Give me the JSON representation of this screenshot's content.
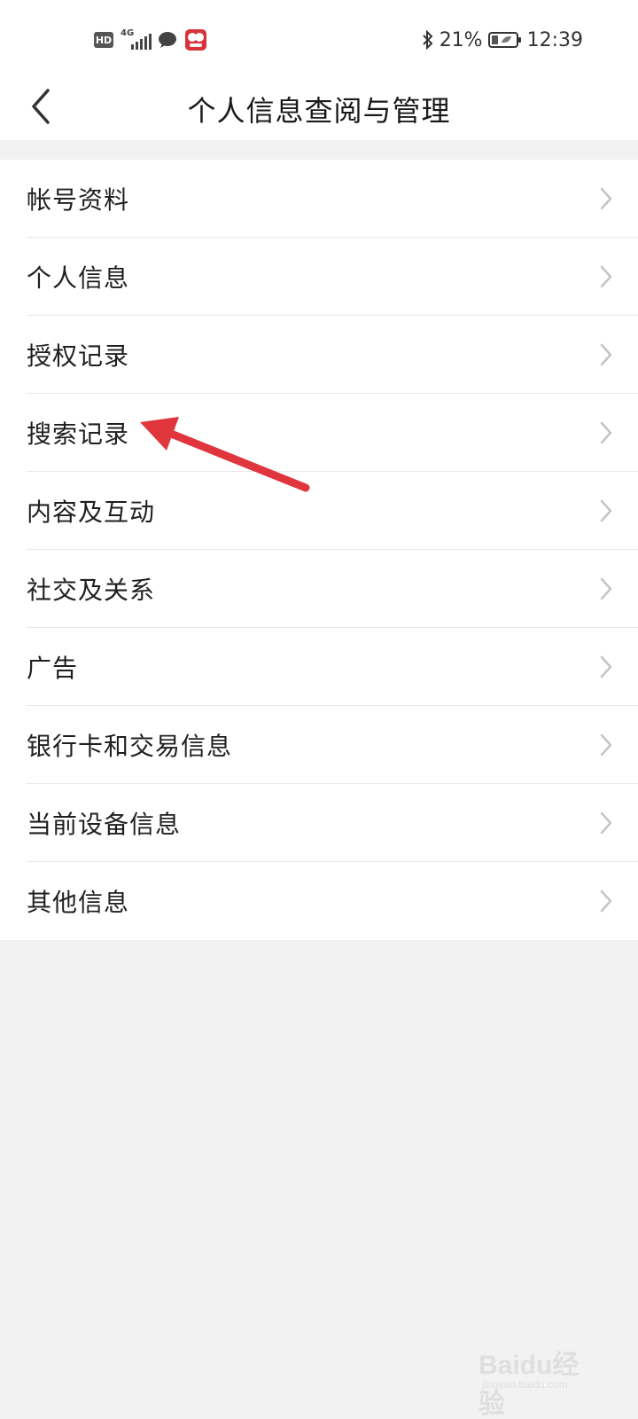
{
  "status_bar": {
    "hd_label": "HD",
    "network_label": "4G",
    "battery_percent": "21%",
    "time": "12:39",
    "icons": [
      "hd-icon",
      "signal-icon",
      "chat-icon",
      "app-icon",
      "bluetooth-icon",
      "battery-icon"
    ]
  },
  "header": {
    "title": "个人信息查阅与管理",
    "back_icon": "chevron-left-icon"
  },
  "menu": {
    "items": [
      {
        "label": "帐号资料"
      },
      {
        "label": "个人信息"
      },
      {
        "label": "授权记录"
      },
      {
        "label": "搜索记录"
      },
      {
        "label": "内容及互动"
      },
      {
        "label": "社交及关系"
      },
      {
        "label": "广告"
      },
      {
        "label": "银行卡和交易信息"
      },
      {
        "label": "当前设备信息"
      },
      {
        "label": "其他信息"
      }
    ],
    "item_icon": "chevron-right-icon"
  },
  "annotation": {
    "arrow_color": "#e0353d",
    "points_to": "搜索记录"
  },
  "watermark": {
    "logo": "Baidu经验",
    "sub": "jingyan.baidu.com"
  }
}
